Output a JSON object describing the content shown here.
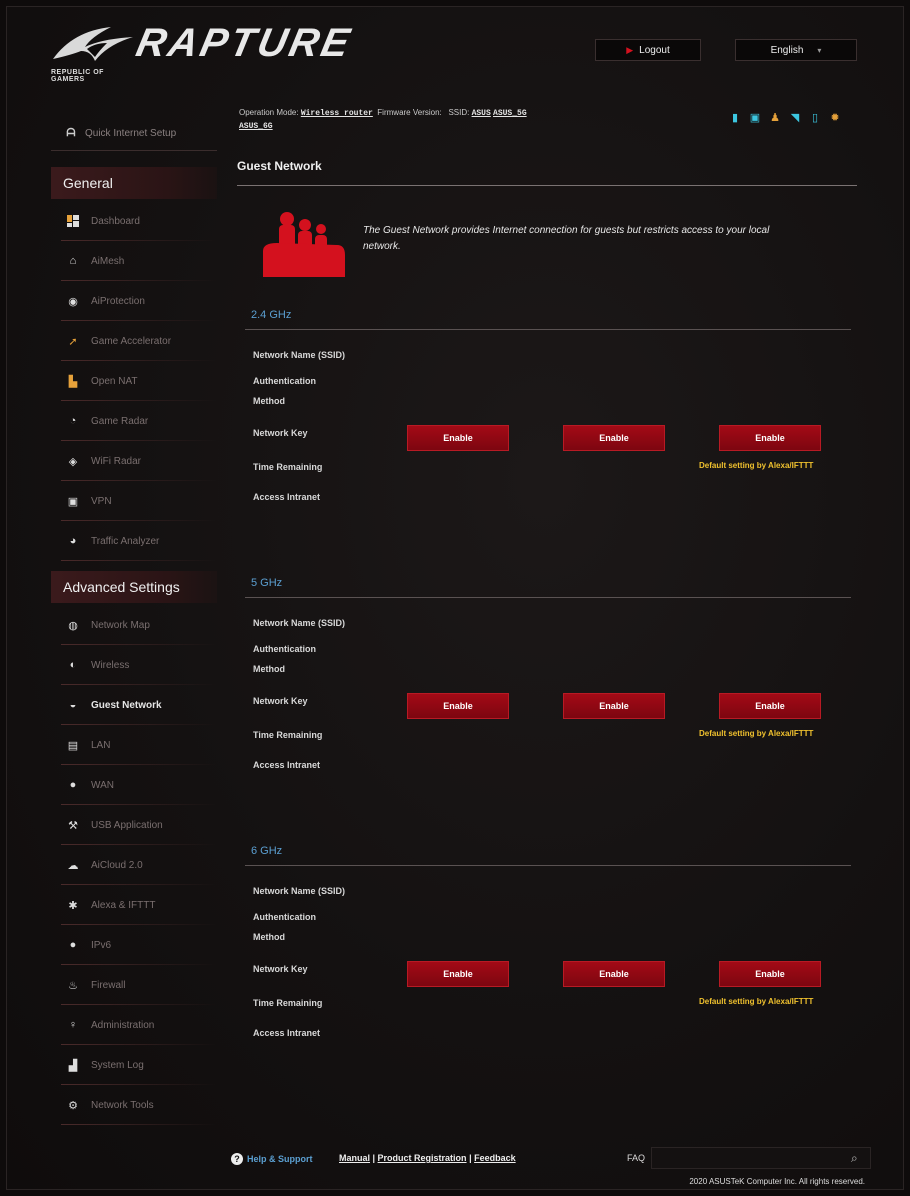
{
  "header": {
    "brand_line": "REPUBLIC OF GAMERS",
    "product": "RAPTURE",
    "logout_label": "Logout",
    "language": "English"
  },
  "sidebar": {
    "quick_setup": "Quick Internet Setup",
    "general_title": "General",
    "general_items": [
      {
        "label": "Dashboard",
        "icon": "dashboard-icon"
      },
      {
        "label": "AiMesh",
        "icon": "aimesh-icon"
      },
      {
        "label": "AiProtection",
        "icon": "aiprotection-icon"
      },
      {
        "label": "Game Accelerator",
        "icon": "rocket-icon"
      },
      {
        "label": "Open NAT",
        "icon": "open-nat-icon"
      },
      {
        "label": "Game Radar",
        "icon": "radar-icon"
      },
      {
        "label": "WiFi Radar",
        "icon": "wifi-radar-icon"
      },
      {
        "label": "VPN",
        "icon": "vpn-icon"
      },
      {
        "label": "Traffic Analyzer",
        "icon": "traffic-analyzer-icon"
      }
    ],
    "advanced_title": "Advanced Settings",
    "advanced_items": [
      {
        "label": "Network Map",
        "icon": "network-map-icon"
      },
      {
        "label": "Wireless",
        "icon": "wireless-icon"
      },
      {
        "label": "Guest Network",
        "icon": "guest-network-icon",
        "active": true
      },
      {
        "label": "LAN",
        "icon": "lan-icon"
      },
      {
        "label": "WAN",
        "icon": "wan-icon"
      },
      {
        "label": "USB Application",
        "icon": "usb-icon"
      },
      {
        "label": "AiCloud 2.0",
        "icon": "cloud-icon"
      },
      {
        "label": "Alexa & IFTTT",
        "icon": "alexa-icon"
      },
      {
        "label": "IPv6",
        "icon": "ipv6-icon"
      },
      {
        "label": "Firewall",
        "icon": "firewall-icon"
      },
      {
        "label": "Administration",
        "icon": "administration-icon"
      },
      {
        "label": "System Log",
        "icon": "system-log-icon"
      },
      {
        "label": "Network Tools",
        "icon": "network-tools-icon"
      }
    ]
  },
  "status": {
    "op_mode_label": "Operation Mode:",
    "op_mode_value": "Wireless router",
    "firmware_label": "Firmware Version:",
    "ssid_label": "SSID:",
    "ssid_values": [
      "ASUS",
      "ASUS_5G",
      "ASUS_6G"
    ]
  },
  "main": {
    "title": "Guest Network",
    "description": "The Guest Network provides Internet connection for guests but restricts access to your local network.",
    "fields": [
      "Network Name (SSID)",
      "Authentication Method",
      "Network Key",
      "Time Remaining",
      "Access Intranet"
    ],
    "enable_label": "Enable",
    "default_note": "Default setting by Alexa/IFTTT",
    "bands": [
      "2.4 GHz",
      "5 GHz",
      "6 GHz"
    ]
  },
  "footer": {
    "help_label": "Help & Support",
    "manual": "Manual",
    "product_registration": "Product Registration",
    "feedback": "Feedback",
    "separator": " | ",
    "faq_label": "FAQ",
    "copyright": "2020 ASUSTeK Computer Inc. All rights reserved."
  },
  "colors": {
    "accent_red": "#a30a16",
    "band_blue": "#5b9fd1",
    "note_yellow": "#f0c12e"
  }
}
